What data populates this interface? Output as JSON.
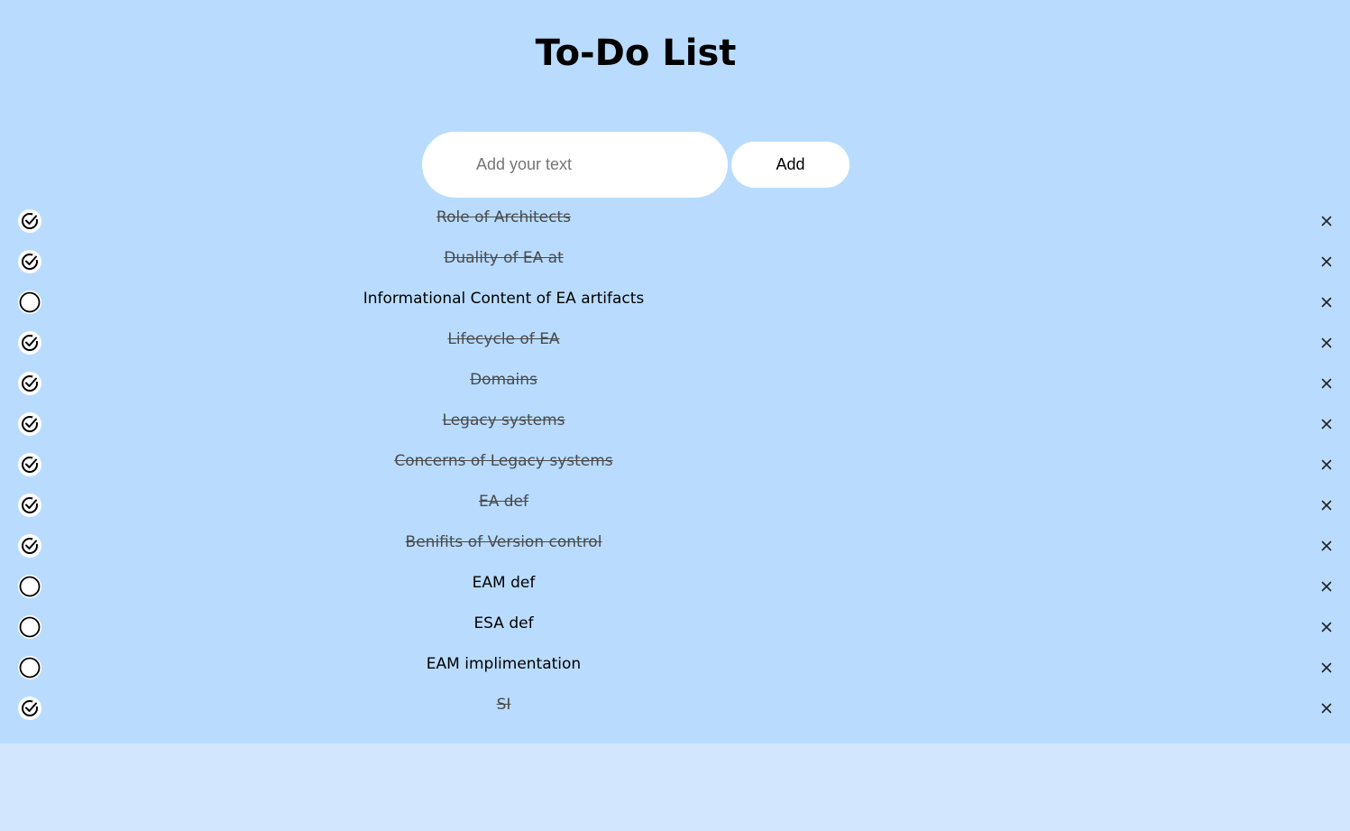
{
  "app": {
    "title": "To-Do List"
  },
  "input": {
    "placeholder": "Add your text",
    "value": ""
  },
  "add_button": {
    "label": "Add"
  },
  "tasks": [
    {
      "text": "Role of Architects",
      "done": true
    },
    {
      "text": "Duality of EA at",
      "done": true
    },
    {
      "text": "Informational Content of EA artifacts",
      "done": false
    },
    {
      "text": "Lifecycle of EA",
      "done": true
    },
    {
      "text": "Domains",
      "done": true
    },
    {
      "text": "Legacy systems",
      "done": true
    },
    {
      "text": "Concerns of Legacy systems",
      "done": true
    },
    {
      "text": "EA def",
      "done": true
    },
    {
      "text": "Benifits of Version control",
      "done": true
    },
    {
      "text": "EAM def",
      "done": false
    },
    {
      "text": "ESA def",
      "done": false
    },
    {
      "text": "EAM implimentation",
      "done": false
    },
    {
      "text": "SI",
      "done": true
    }
  ],
  "icons": {
    "checked": "checked-circle-icon",
    "unchecked": "empty-circle-icon",
    "delete": "close-icon"
  },
  "colors": {
    "panel_background": "#b9dcfe",
    "page_background": "#d2e6fe",
    "done_text": "#4a4a4a"
  }
}
